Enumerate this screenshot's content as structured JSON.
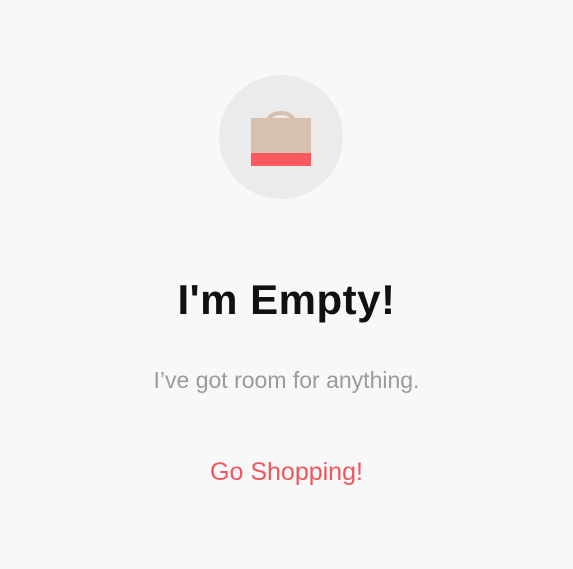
{
  "empty_state": {
    "icon": "shopping-bag-icon",
    "title": "I'm Empty!",
    "subtitle": "I’ve got room for anything.",
    "cta_label": "Go Shopping!"
  },
  "colors": {
    "background": "#f8f8f8",
    "icon_circle": "#ebebeb",
    "bag_body": "#d8c0ae",
    "bag_stripe": "#ff5860",
    "title": "#111111",
    "subtitle": "#9b9b9b",
    "accent": "#f0565d"
  }
}
